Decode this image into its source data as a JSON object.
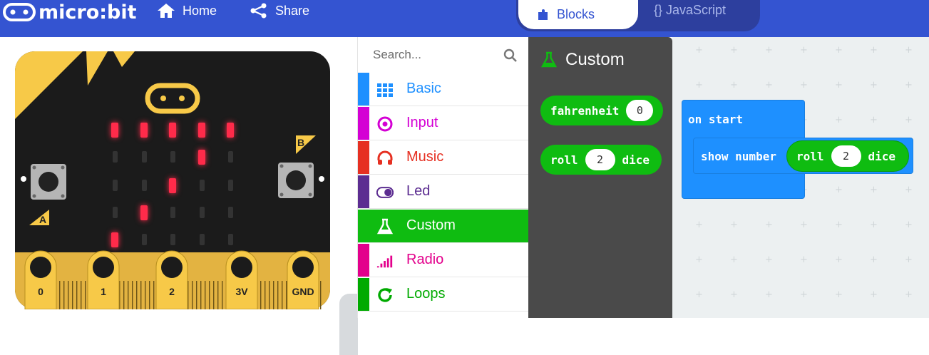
{
  "header": {
    "logo_text": "micro:bit",
    "home_label": "Home",
    "share_label": "Share",
    "blocks_label": "Blocks",
    "javascript_label": "{} JavaScript",
    "bar_color": "#3454d1"
  },
  "simulator": {
    "button_a": "A",
    "button_b": "B",
    "pins": [
      "0",
      "1",
      "2",
      "3V",
      "GND"
    ],
    "led_matrix": [
      [
        1,
        1,
        1,
        1,
        1
      ],
      [
        0,
        0,
        0,
        1,
        0
      ],
      [
        0,
        0,
        1,
        0,
        0
      ],
      [
        0,
        1,
        0,
        0,
        0
      ],
      [
        1,
        0,
        0,
        0,
        0
      ]
    ]
  },
  "toolbox": {
    "search_placeholder": "Search...",
    "categories": [
      {
        "label": "Basic",
        "color": "#1e90ff",
        "icon": "grid-icon"
      },
      {
        "label": "Input",
        "color": "#d400d4",
        "icon": "target-icon"
      },
      {
        "label": "Music",
        "color": "#e63022",
        "icon": "headphones-icon"
      },
      {
        "label": "Led",
        "color": "#5c2d91",
        "icon": "toggle-icon"
      },
      {
        "label": "Custom",
        "color": "#0fbc11",
        "icon": "flask-icon",
        "selected": true
      },
      {
        "label": "Radio",
        "color": "#e3008c",
        "icon": "signal-icon"
      },
      {
        "label": "Loops",
        "color": "#00aa00",
        "icon": "loop-icon"
      }
    ]
  },
  "flyout": {
    "title": "Custom",
    "blocks": [
      {
        "label": "fahrenheit",
        "value": "0"
      },
      {
        "label": "roll",
        "value": "2",
        "suffix": "dice"
      }
    ]
  },
  "workspace": {
    "on_start_label": "on start",
    "show_number_label": "show number",
    "roll_label": "roll",
    "roll_value": "2",
    "roll_suffix": "dice"
  }
}
